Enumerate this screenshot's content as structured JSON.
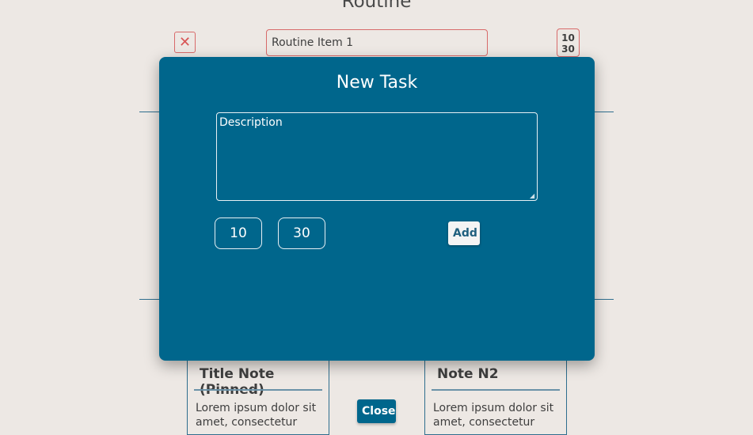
{
  "page": {
    "title": "Routine",
    "routine_item": {
      "value": "Routine Item 1",
      "hour": "10",
      "minute": "30",
      "remove_icon": "close-x-icon"
    },
    "notes": [
      {
        "title": "Title Note (Pinned)",
        "body": "Lorem ipsum dolor sit amet, consectetur"
      },
      {
        "title": "Note N2",
        "body": "Lorem ipsum dolor sit amet, consectetur"
      }
    ],
    "close_label": "Close"
  },
  "modal": {
    "title": "New Task",
    "description_placeholder": "Description",
    "hour": "10",
    "minute": "30",
    "add_label": "Add"
  },
  "colors": {
    "background": "#ede8e4",
    "modal": "#00668c",
    "danger": "#d86a6a",
    "divider": "#2e6e8e"
  }
}
